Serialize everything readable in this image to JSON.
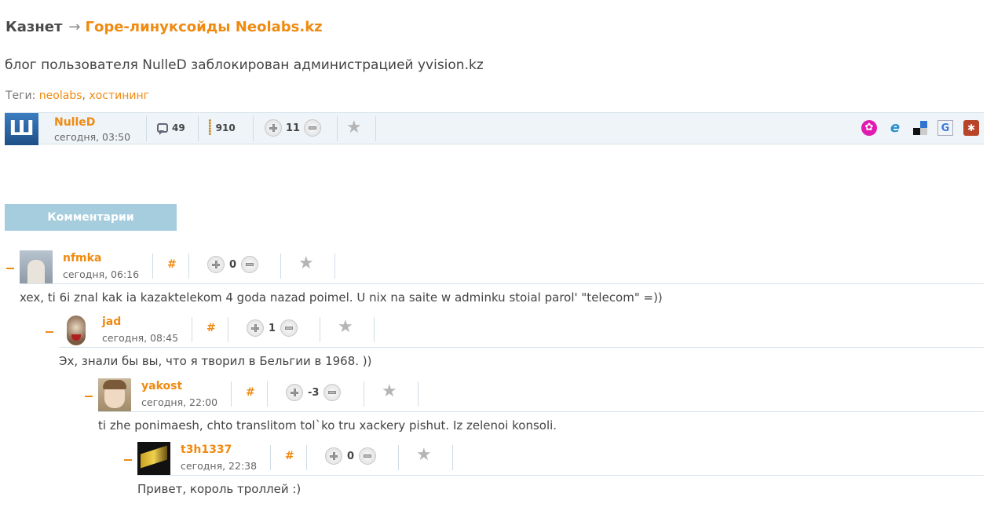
{
  "breadcrumb": {
    "home": "Казнет",
    "arrow": "→",
    "current": "Горе-линуксойды Neolabs.kz"
  },
  "subtitle": "блог пользователя NulleD заблокирован администрацией yvision.kz",
  "tags": {
    "label": "Теги:",
    "items": [
      "neolabs",
      "хостининг"
    ],
    "separator": ","
  },
  "post": {
    "author": "NulleD",
    "time": "сегодня, 03:50",
    "comments_count": "49",
    "views_count": "910",
    "score": "11"
  },
  "comments_header": "Комментарии",
  "comments": [
    {
      "author": "nfmka",
      "time": "сегодня, 06:16",
      "hash": "#",
      "score": "0",
      "text": "xex, ti 6i znal kak ia kazaktelekom 4 goda nazad poimel. U nix na saite w adminku stoial parol' \"telecom\" =))"
    },
    {
      "author": "jad",
      "time": "сегодня, 08:45",
      "hash": "#",
      "score": "1",
      "text": "Эх, знали бы вы, что я творил в Бельгии в 1968. ))"
    },
    {
      "author": "yakost",
      "time": "сегодня, 22:00",
      "hash": "#",
      "score": "-3",
      "text": "ti zhe ponimaesh, chto translitom tol`ko tru xackery pishut. Iz zelenoi konsoli."
    },
    {
      "author": "t3h1337",
      "time": "сегодня, 22:38",
      "hash": "#",
      "score": "0",
      "text": "Привет, король троллей :)"
    }
  ],
  "colors": {
    "accent": "#f08a10",
    "header_bg": "#a6cddd",
    "bar_bg": "#eef4f8"
  },
  "icons": {
    "share": [
      "moimir-icon",
      "livejournal-icon",
      "delicious-icon",
      "google-bookmarks-icon",
      "bobrdobr-icon"
    ]
  }
}
